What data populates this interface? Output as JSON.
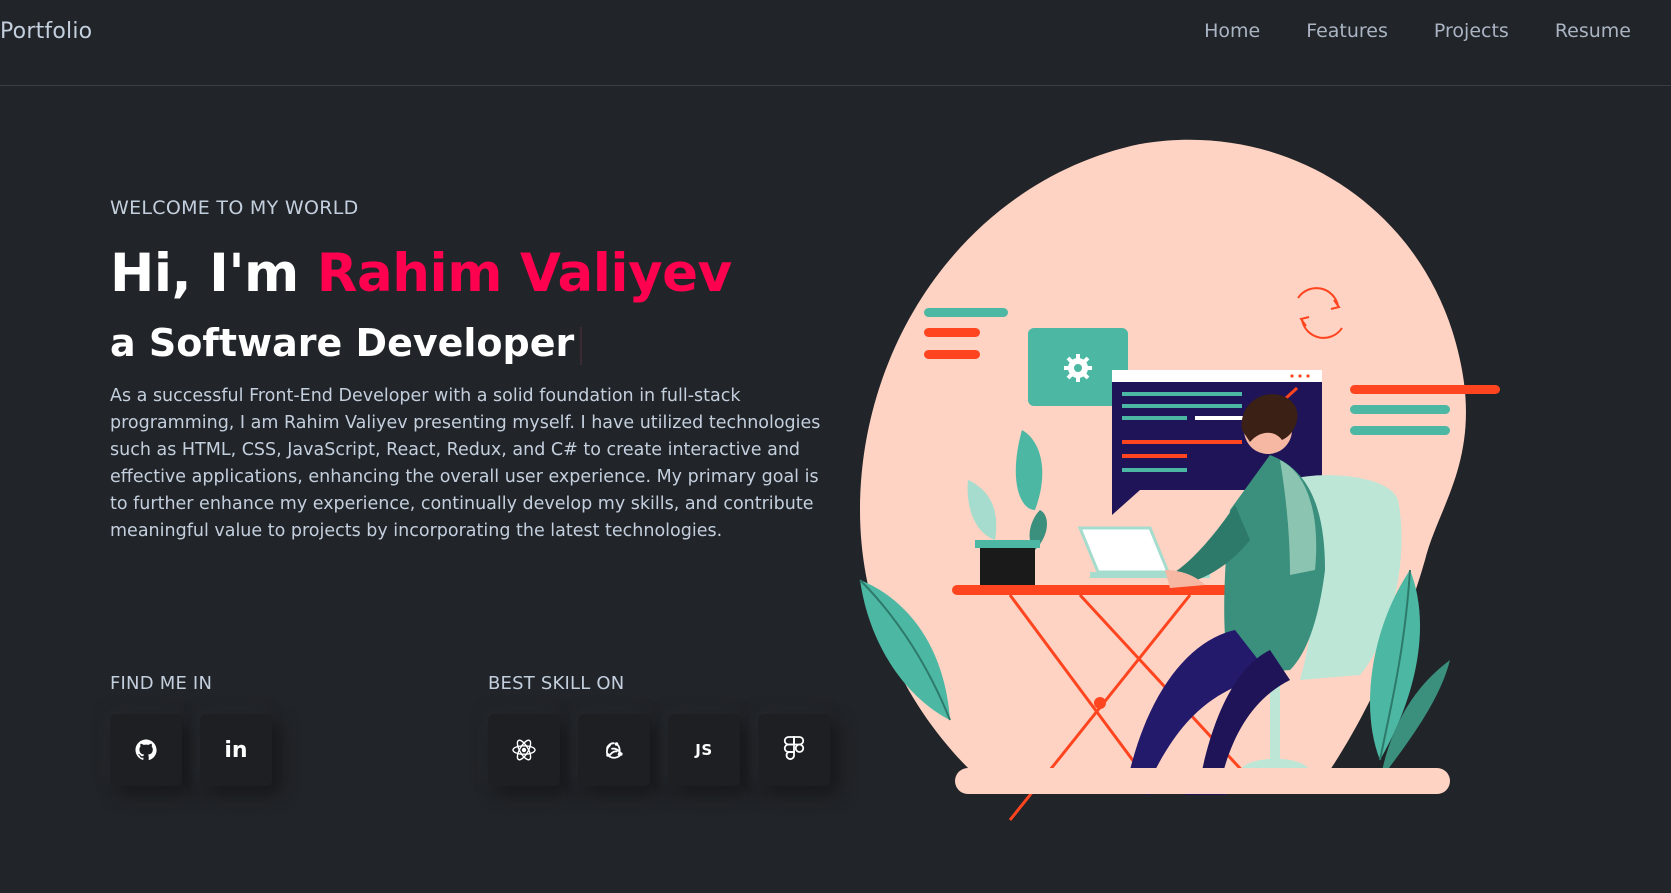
{
  "header": {
    "logo": "Portfolio",
    "nav": [
      "Home",
      "Features",
      "Projects",
      "Resume"
    ]
  },
  "hero": {
    "welcome": "WELCOME TO MY WORLD",
    "greeting": "Hi, I'm",
    "name": "Rahim Valiyev",
    "role": "a Software Developer",
    "description": "As a successful Front-End Developer with a solid foundation in full-stack programming, I am Rahim Valiyev presenting myself. I have utilized technologies such as HTML, CSS, JavaScript, React, Redux, and C# to create interactive and effective applications, enhancing the overall user experience. My primary goal is to further enhance my experience, continually develop my skills, and contribute meaningful value to projects by incorporating the latest technologies."
  },
  "find_me": {
    "title": "FIND ME IN",
    "icons": [
      "github-icon",
      "linkedin-icon"
    ],
    "linkedin_text": "in"
  },
  "skills": {
    "title": "BEST SKILL ON",
    "icons": [
      "react-icon",
      "redux-icon",
      "javascript-icon",
      "figma-icon"
    ],
    "js_text": "JS"
  },
  "colors": {
    "background": "#212428",
    "accent": "#ff014f",
    "text": "#c4cfde",
    "button": "#1d1f23"
  }
}
